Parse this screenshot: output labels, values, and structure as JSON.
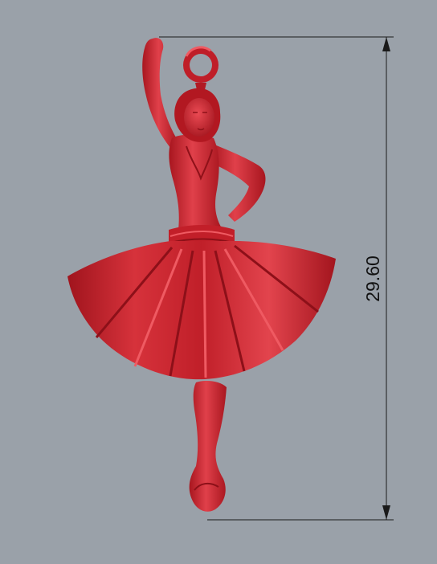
{
  "viewport": {
    "background": "#9aa1a9",
    "model": {
      "name": "dancer-pendant",
      "color": "#c8222c",
      "highlight": "#ef4650",
      "shadow": "#8a1118"
    },
    "dimension": {
      "value": "29.60",
      "line_color": "#1a1a1a"
    }
  }
}
